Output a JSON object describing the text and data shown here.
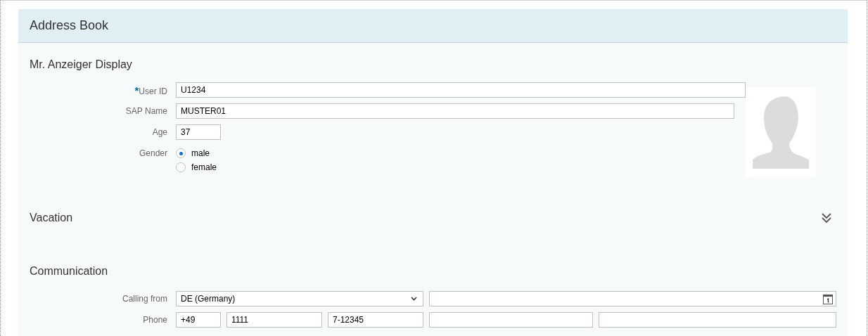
{
  "panel": {
    "title": "Address Book"
  },
  "person": {
    "title": "Mr. Anzeiger Display",
    "fields": [
      {
        "label": "User ID",
        "required_mark": "*",
        "value": "U1234"
      },
      {
        "label": "SAP Name",
        "value": "MUSTER01"
      },
      {
        "label": "Age",
        "value": "37"
      }
    ],
    "gender": {
      "label": "Gender",
      "options": [
        {
          "label": "male",
          "selected": true
        },
        {
          "label": "female",
          "selected": false
        }
      ]
    }
  },
  "vacation": {
    "title": "Vacation",
    "expanded": false
  },
  "communication": {
    "title": "Communication",
    "calling_from": {
      "label": "Calling from",
      "value": "DE (Germany)"
    },
    "rows": [
      {
        "label": "Phone",
        "values": [
          "+49",
          "1111",
          "7-12345"
        ]
      }
    ]
  }
}
